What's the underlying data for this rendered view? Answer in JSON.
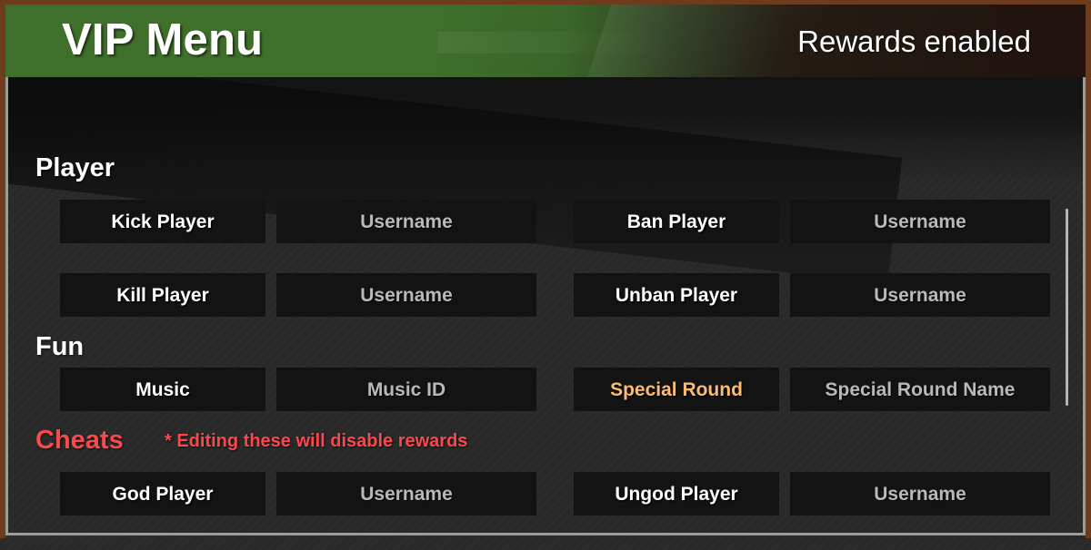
{
  "header": {
    "title": "VIP Menu",
    "status": "Rewards enabled"
  },
  "colors": {
    "header_green": "#3f6f2b",
    "frame_brown": "#6d3c1c",
    "panel_bg": "#292929",
    "control_bg": "#131313",
    "accent_orange": "#ffbc6e",
    "danger_red": "#f9494d",
    "placeholder_gray": "#b9b9b9",
    "scrollbar": "#b4b4b4"
  },
  "sections": [
    {
      "id": "player",
      "title": "Player",
      "rows": [
        {
          "left": {
            "button": "Kick Player",
            "field_placeholder": "Username"
          },
          "right": {
            "button": "Ban Player",
            "field_placeholder": "Username"
          }
        },
        {
          "left": {
            "button": "Kill Player",
            "field_placeholder": "Username"
          },
          "right": {
            "button": "Unban Player",
            "field_placeholder": "Username"
          }
        }
      ]
    },
    {
      "id": "fun",
      "title": "Fun",
      "rows": [
        {
          "left": {
            "button": "Music",
            "field_placeholder": "Music ID"
          },
          "right": {
            "button": "Special Round",
            "field_placeholder": "Special Round Name"
          }
        }
      ]
    },
    {
      "id": "cheats",
      "title": "Cheats",
      "note": "* Editing these will disable rewards",
      "rows": [
        {
          "left": {
            "button": "God Player",
            "field_placeholder": "Username"
          },
          "right": {
            "button": "Ungod Player",
            "field_placeholder": "Username"
          }
        }
      ]
    }
  ],
  "scrollbar": {
    "orientation": "vertical",
    "position": "right"
  }
}
